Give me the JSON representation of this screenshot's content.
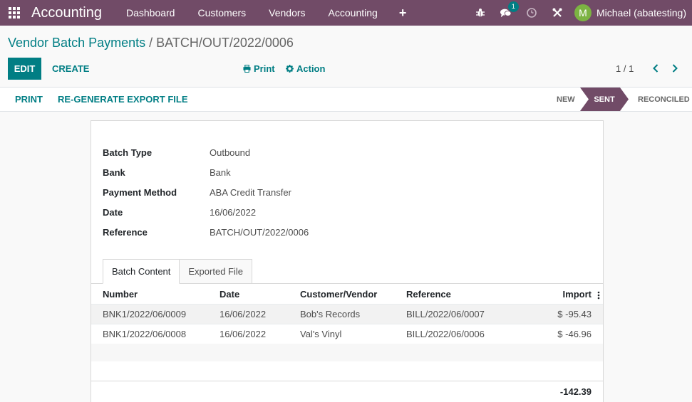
{
  "navbar": {
    "app_name": "Accounting",
    "menu": [
      "Dashboard",
      "Customers",
      "Vendors",
      "Accounting"
    ],
    "plus": "+",
    "message_count": "1",
    "avatar_letter": "M",
    "user_name": "Michael (abatesting)"
  },
  "breadcrumb": {
    "parent": "Vendor Batch Payments",
    "separator": "/",
    "current": "BATCH/OUT/2022/0006"
  },
  "toolbar": {
    "edit_label": "EDIT",
    "create_label": "CREATE",
    "print_label": "Print",
    "action_label": "Action",
    "pager": "1 / 1"
  },
  "statusbar": {
    "print_label": "PRINT",
    "regen_label": "RE-GENERATE EXPORT FILE",
    "stages": [
      "NEW",
      "SENT",
      "RECONCILED"
    ],
    "active_stage": "SENT"
  },
  "form": {
    "fields": [
      {
        "label": "Batch Type",
        "value": "Outbound"
      },
      {
        "label": "Bank",
        "value": "Bank"
      },
      {
        "label": "Payment Method",
        "value": "ABA Credit Transfer"
      },
      {
        "label": "Date",
        "value": "16/06/2022"
      },
      {
        "label": "Reference",
        "value": "BATCH/OUT/2022/0006"
      }
    ],
    "tabs": [
      "Batch Content",
      "Exported File"
    ],
    "active_tab": "Batch Content"
  },
  "table": {
    "headers": [
      "Number",
      "Date",
      "Customer/Vendor",
      "Reference",
      "Import"
    ],
    "rows": [
      [
        "BNK1/2022/06/0009",
        "16/06/2022",
        "Bob's Records",
        "BILL/2022/06/0007",
        "$ -95.43"
      ],
      [
        "BNK1/2022/06/0008",
        "16/06/2022",
        "Val's Vinyl",
        "BILL/2022/06/0006",
        "$ -46.96"
      ]
    ],
    "total": "-142.39"
  },
  "colors": {
    "navbar": "#714b67",
    "primary": "#017e84",
    "avatar": "#7cb342"
  }
}
